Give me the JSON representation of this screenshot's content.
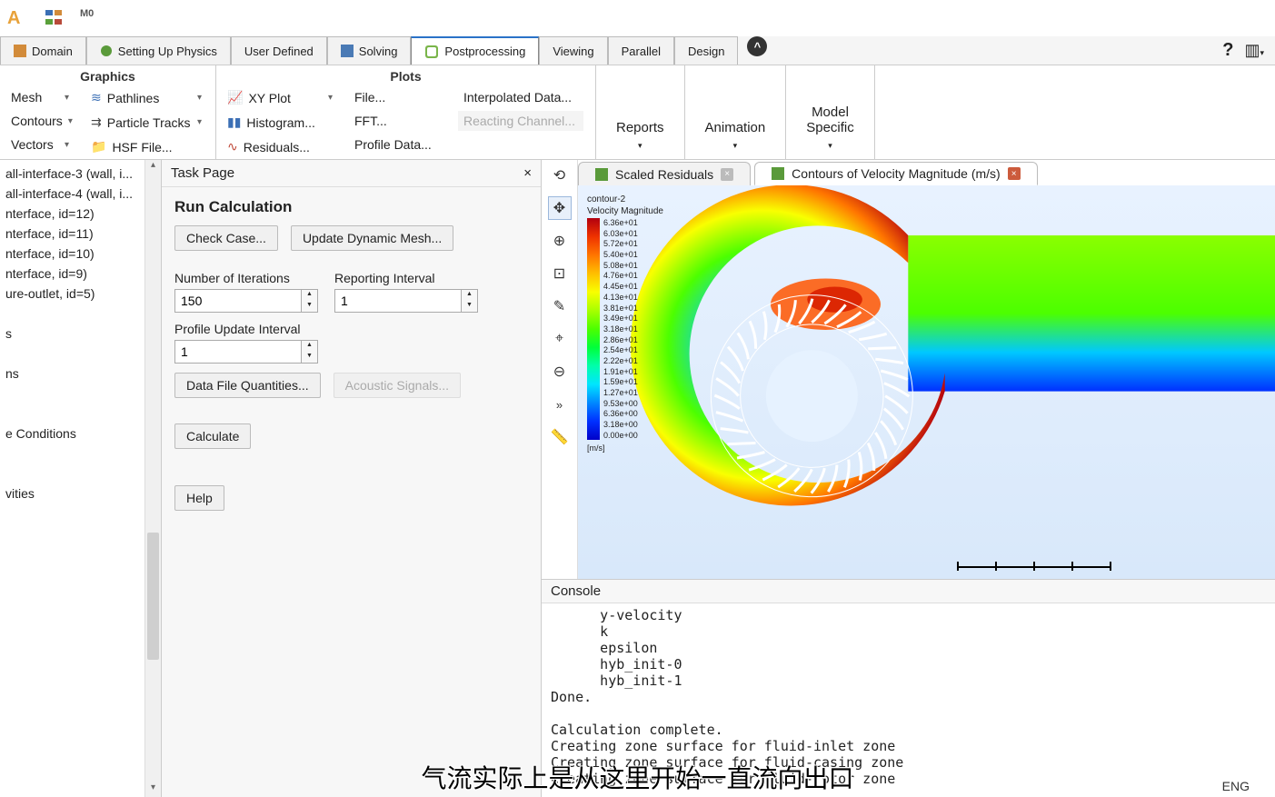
{
  "top_icons": [
    "A",
    "tools",
    "M0"
  ],
  "tabs": {
    "domain": "Domain",
    "physics": "Setting Up Physics",
    "user_defined": "User Defined",
    "solving": "Solving",
    "postprocessing": "Postprocessing",
    "viewing": "Viewing",
    "parallel": "Parallel",
    "design": "Design"
  },
  "ribbon": {
    "graphics_title": "Graphics",
    "plots_title": "Plots",
    "mesh": "Mesh",
    "contours": "Contours",
    "vectors": "Vectors",
    "pathlines": "Pathlines",
    "particle_tracks": "Particle Tracks",
    "hsf_file": "HSF File...",
    "xy_plot": "XY Plot",
    "histogram": "Histogram...",
    "residuals": "Residuals...",
    "file": "File...",
    "fft": "FFT...",
    "profile_data": "Profile Data...",
    "interpolated_data": "Interpolated Data...",
    "reacting_channel": "Reacting Channel...",
    "reports": "Reports",
    "animation": "Animation",
    "model_specific": "Model\nSpecific",
    "help_glyph": "?",
    "layout_glyph": "⊞"
  },
  "tree": {
    "items": [
      "all-interface-3 (wall, i...",
      "all-interface-4 (wall, i...",
      "nterface, id=12)",
      "nterface, id=11)",
      "nterface, id=10)",
      "nterface, id=9)",
      "ure-outlet, id=5)",
      "",
      "s",
      "",
      "ns",
      "",
      "",
      "e Conditions",
      "",
      "",
      "vities"
    ]
  },
  "task": {
    "header": "Task Page",
    "close_x": "×",
    "title": "Run Calculation",
    "check_case": "Check Case...",
    "update_mesh": "Update Dynamic Mesh...",
    "num_iter_lbl": "Number of Iterations",
    "num_iter_val": "150",
    "report_int_lbl": "Reporting Interval",
    "report_int_val": "1",
    "profile_int_lbl": "Profile Update Interval",
    "profile_int_val": "1",
    "dfq": "Data File Quantities...",
    "acoustic": "Acoustic Signals...",
    "calculate": "Calculate",
    "help": "Help"
  },
  "view_tabs": {
    "residuals": "Scaled Residuals",
    "contours": "Contours of Velocity Magnitude (m/s)"
  },
  "legend": {
    "title1": "contour-2",
    "title2": "Velocity Magnitude",
    "vals": [
      "6.36e+01",
      "6.03e+01",
      "5.72e+01",
      "5.40e+01",
      "5.08e+01",
      "4.76e+01",
      "4.45e+01",
      "4.13e+01",
      "3.81e+01",
      "3.49e+01",
      "3.18e+01",
      "2.86e+01",
      "2.54e+01",
      "2.22e+01",
      "1.91e+01",
      "1.59e+01",
      "1.27e+01",
      "9.53e+00",
      "6.36e+00",
      "3.18e+00",
      "0.00e+00"
    ],
    "unit": "[m/s]"
  },
  "console": {
    "header": "Console",
    "text": "      y-velocity\n      k\n      epsilon\n      hyb_init-0\n      hyb_init-1\nDone.\n\nCalculation complete.\nCreating zone surface for fluid-inlet zone\nCreating zone surface for fluid-casing zone\nCreating zone surface for fluid-rotor zone"
  },
  "subtitle": "气流实际上是从这里开始一直流向出口",
  "lang": "ENG",
  "chart_data": {
    "type": "contour",
    "title": "Contours of Velocity Magnitude (m/s)",
    "variable": "Velocity Magnitude",
    "unit": "m/s",
    "colormap_range": [
      0.0,
      63.6
    ],
    "colormap_levels": [
      0.0,
      3.18,
      6.36,
      9.53,
      12.7,
      15.9,
      19.1,
      22.2,
      25.4,
      28.6,
      31.8,
      34.9,
      38.1,
      41.3,
      44.5,
      47.6,
      50.8,
      54.0,
      57.2,
      60.3,
      63.6
    ],
    "geometry_description": "Centrifugal fan / blower cross-section: circular volute casing with bladed rotor in center and rectangular outlet duct extending to the right",
    "observed_regions": [
      {
        "region": "rotor blade tips (upper)",
        "approx_value": 60
      },
      {
        "region": "volute upper passage",
        "approx_value": 40
      },
      {
        "region": "outlet duct core",
        "approx_value": 35
      },
      {
        "region": "outlet duct lower wall",
        "approx_value": 5
      },
      {
        "region": "rotor hub / center",
        "approx_value": 0
      },
      {
        "region": "volute lower-left",
        "approx_value": 20
      }
    ]
  }
}
